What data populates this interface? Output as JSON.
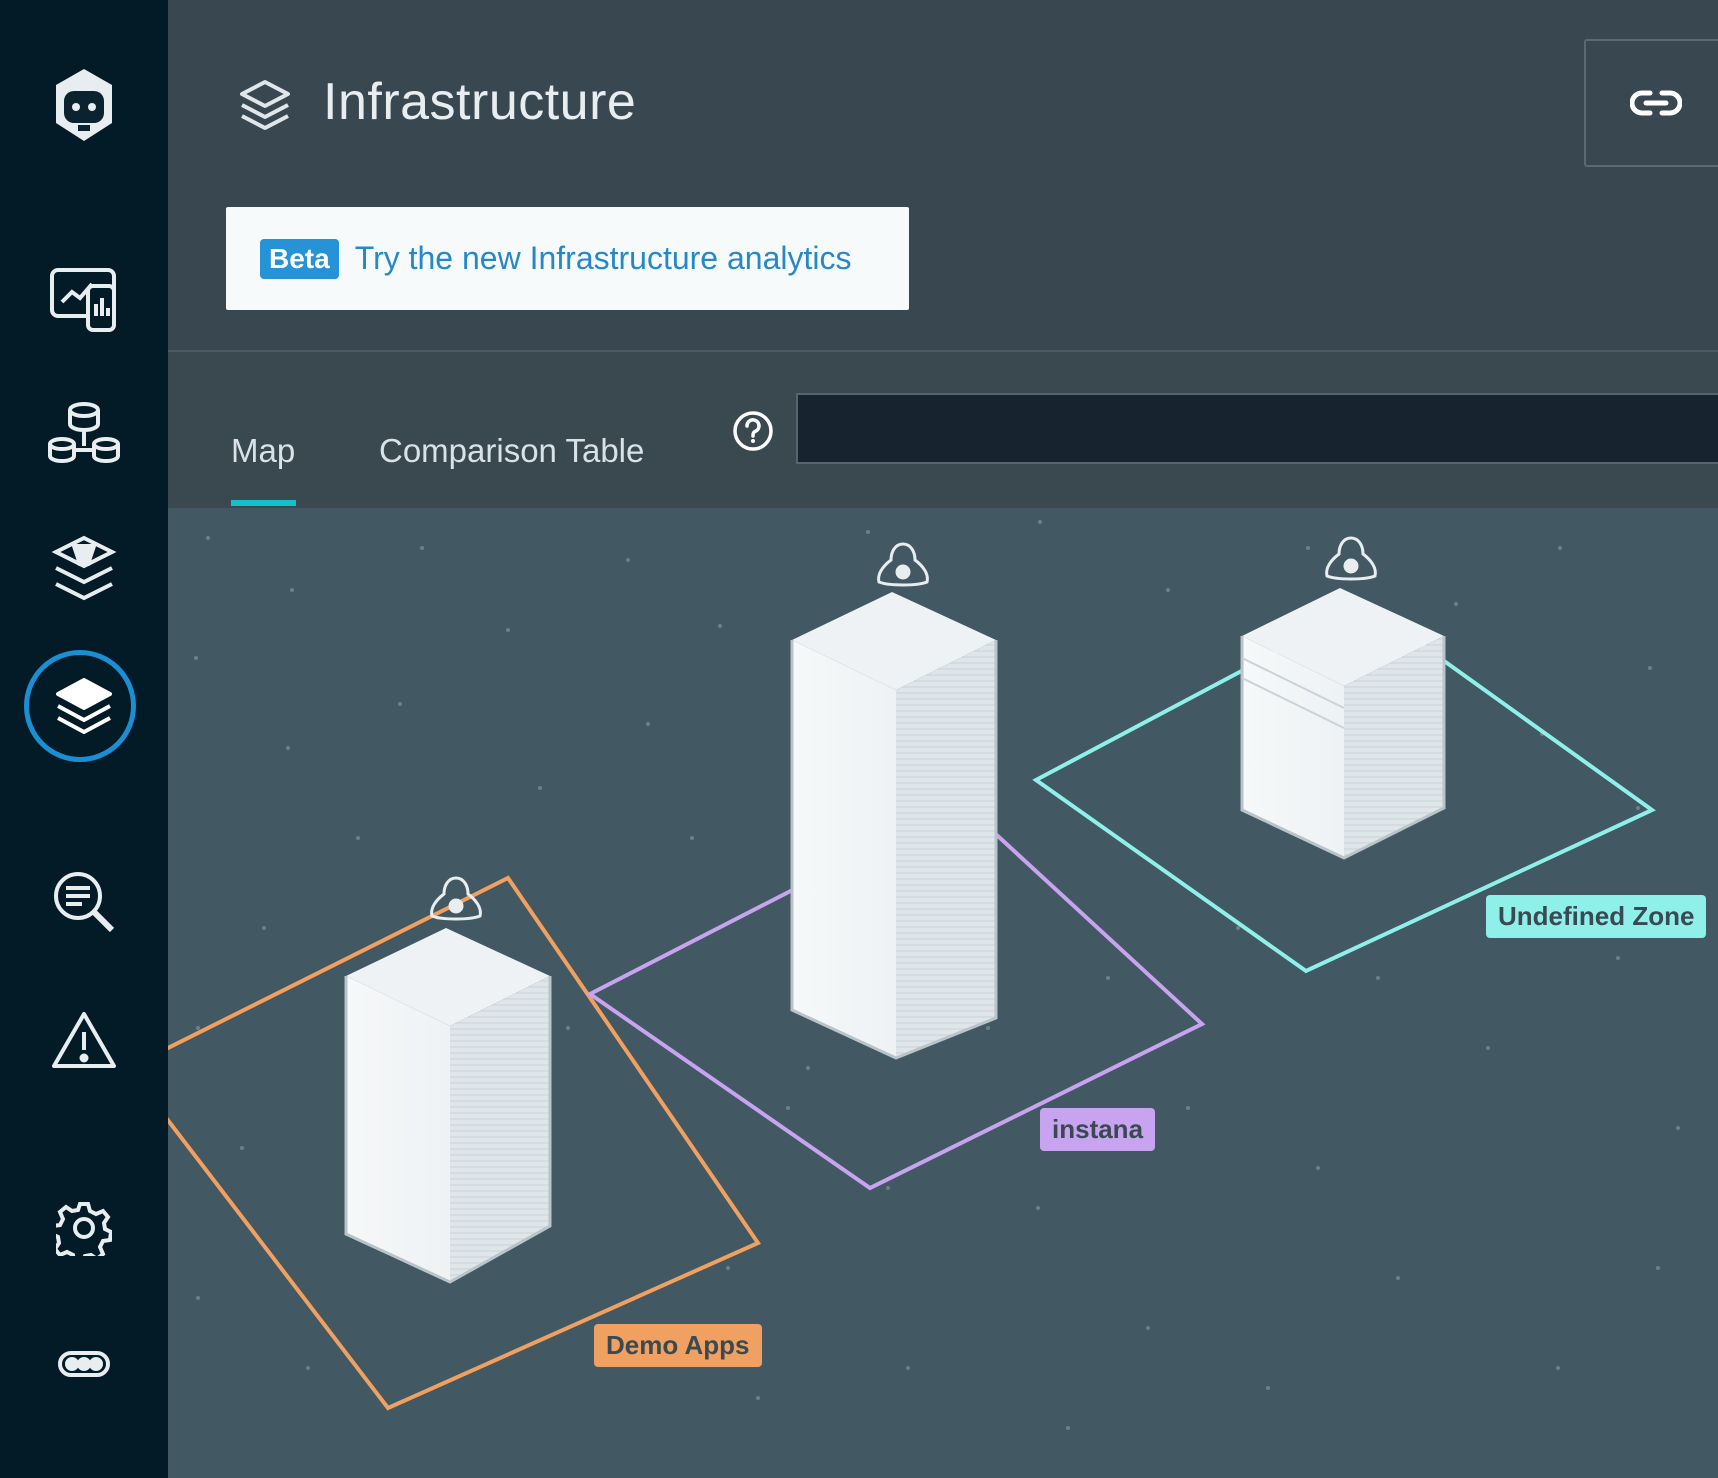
{
  "app": {
    "sidebar": {
      "items": [
        {
          "icon": "instana-robot-logo-icon"
        },
        {
          "icon": "website-mobile-monitoring-icon"
        },
        {
          "icon": "applications-icon"
        },
        {
          "icon": "platforms-icon"
        },
        {
          "icon": "infrastructure-layers-icon",
          "active": true
        },
        {
          "icon": "analytics-search-icon"
        },
        {
          "icon": "events-warning-icon"
        },
        {
          "icon": "settings-gear-icon"
        },
        {
          "icon": "more-icon"
        }
      ],
      "active_ring_color": "#1a8fd3"
    }
  },
  "header": {
    "title": "Infrastructure",
    "title_icon": "layers-icon",
    "link_button_icon": "link-icon"
  },
  "banner": {
    "badge": "Beta",
    "link_text": "Try the new Infrastructure analytics"
  },
  "tabs": [
    {
      "label": "Map",
      "active": true
    },
    {
      "label": "Comparison Table",
      "active": false
    }
  ],
  "search": {
    "value": "",
    "placeholder": ""
  },
  "colors": {
    "tab_active_underline": "#17c0c8",
    "zone_demo_apps": "#f0a060",
    "zone_instana": "#c7a3f0",
    "zone_undefined": "#8ff0ea",
    "map_background": "#425862"
  },
  "map": {
    "zones": [
      {
        "label": "Demo Apps"
      },
      {
        "label": "instana"
      },
      {
        "label": "Undefined Zone"
      }
    ]
  }
}
